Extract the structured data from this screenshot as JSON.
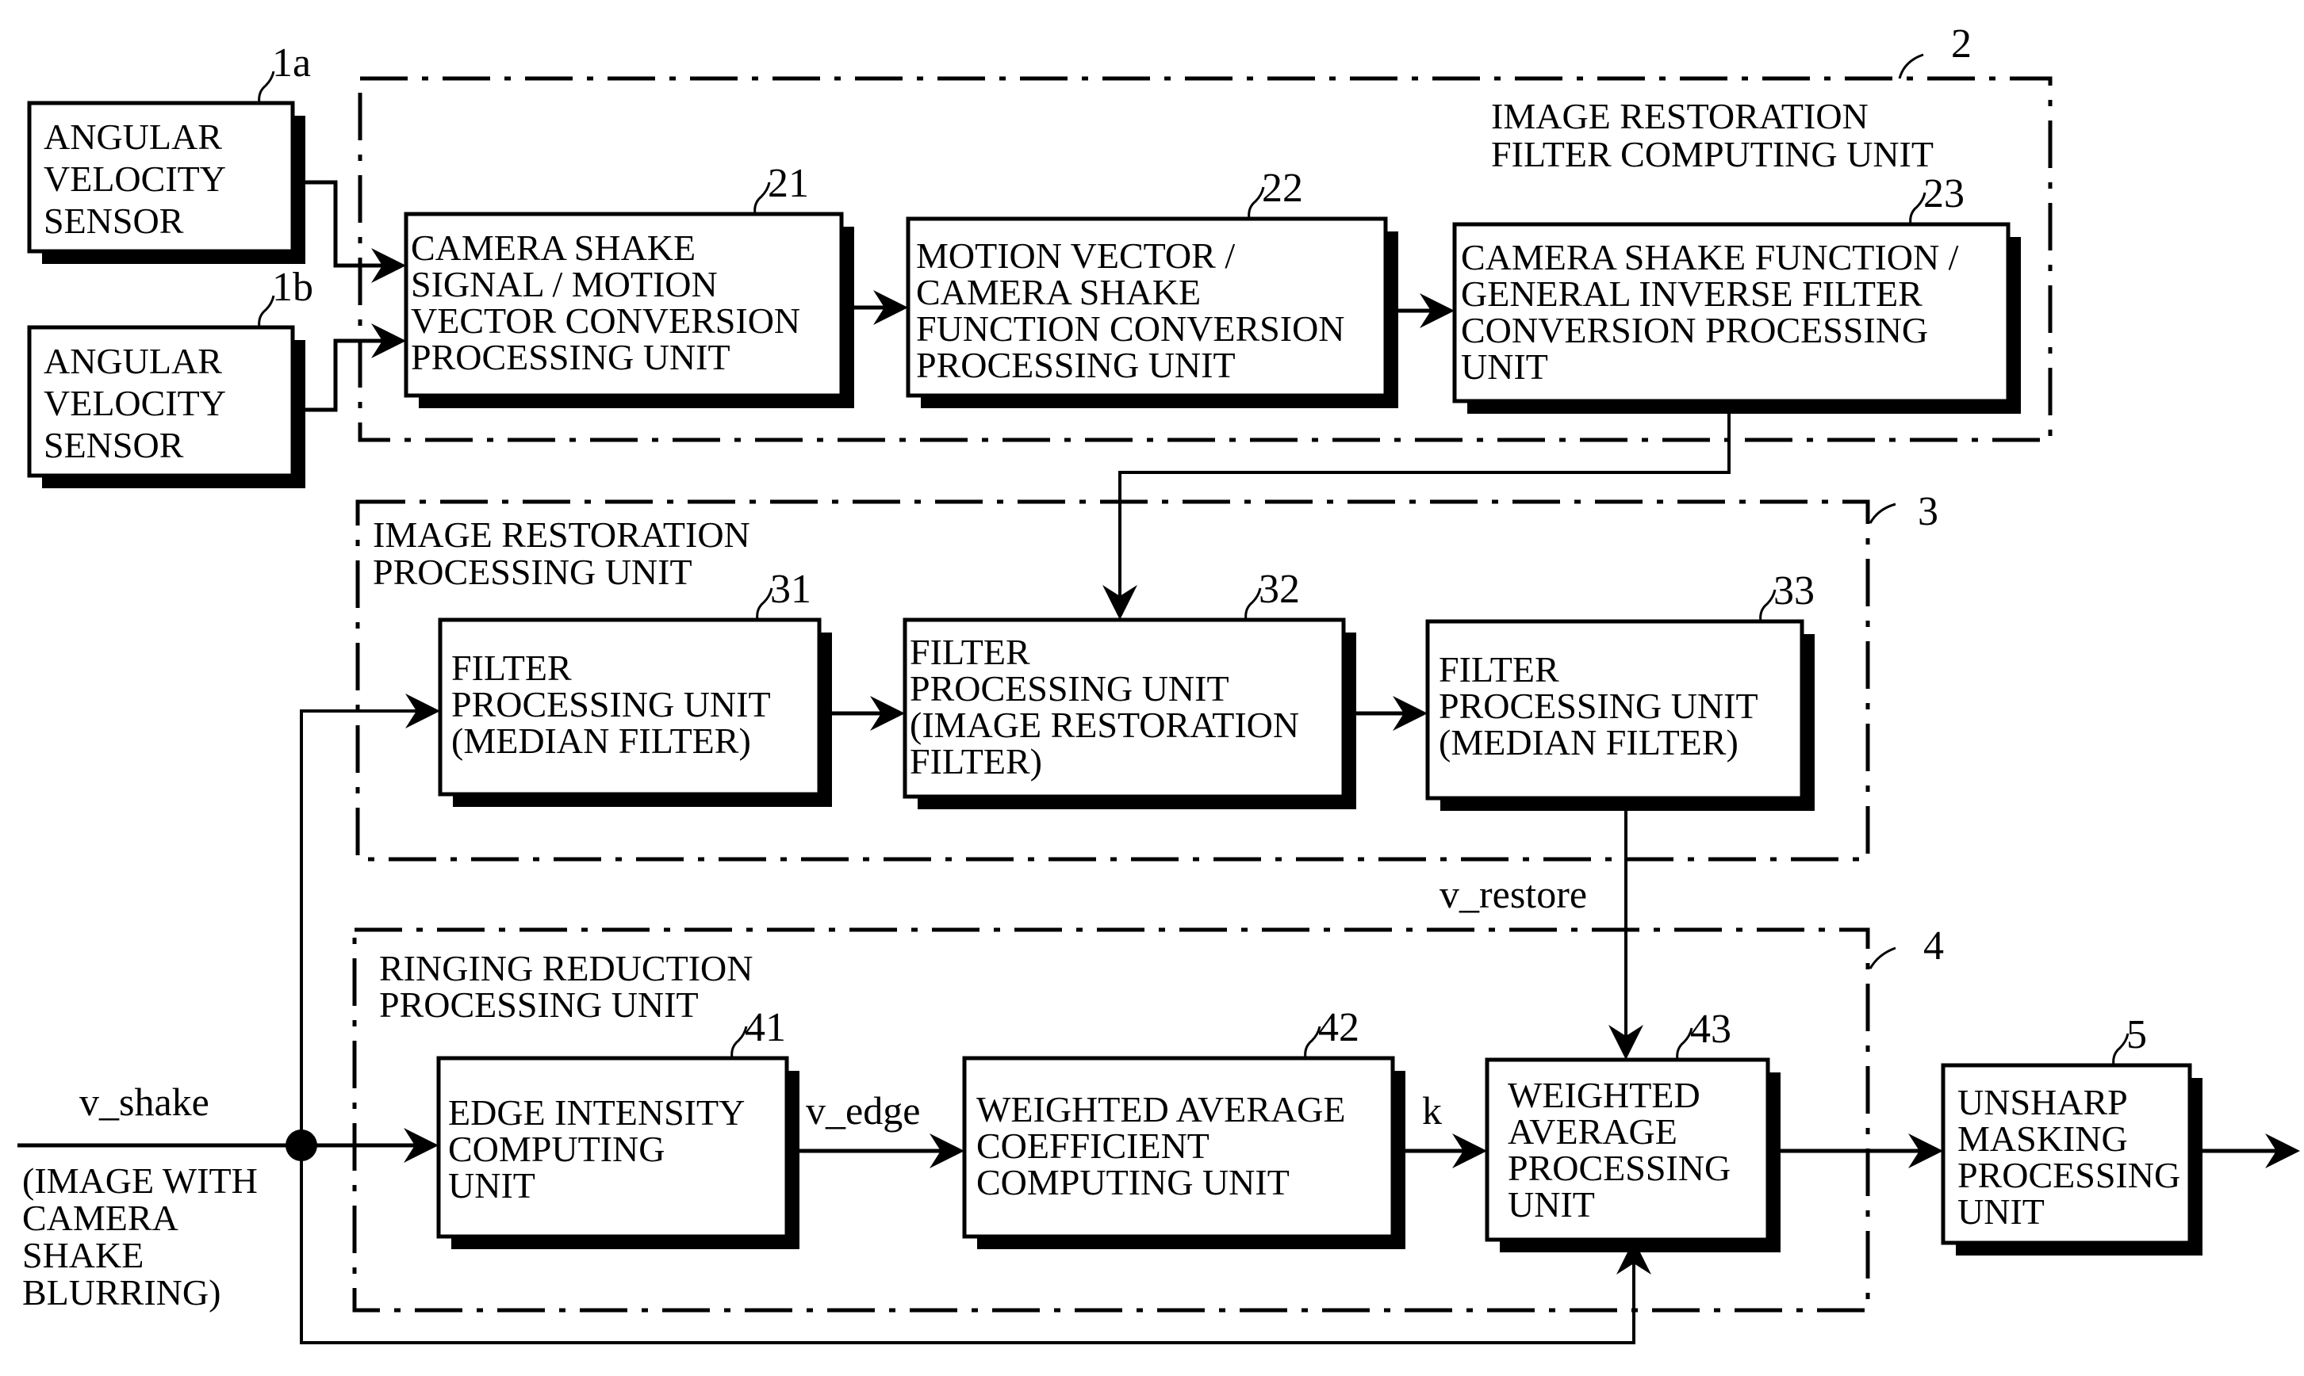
{
  "figure": {
    "groups": {
      "filter_computing": {
        "ref": "2",
        "title_lines": [
          "IMAGE RESTORATION",
          "FILTER COMPUTING UNIT"
        ]
      },
      "restoration_processing": {
        "ref": "3",
        "title_lines": [
          "IMAGE RESTORATION",
          "PROCESSING UNIT"
        ]
      },
      "ringing_reduction": {
        "ref": "4",
        "title_lines": [
          "RINGING REDUCTION",
          "PROCESSING UNIT"
        ]
      }
    },
    "blocks": {
      "sensor_1a": {
        "ref": "1a",
        "lines": [
          "ANGULAR",
          "VELOCITY",
          "SENSOR"
        ]
      },
      "sensor_1b": {
        "ref": "1b",
        "lines": [
          "ANGULAR",
          "VELOCITY",
          "SENSOR"
        ]
      },
      "b21": {
        "ref": "21",
        "lines": [
          "CAMERA SHAKE",
          "SIGNAL / MOTION",
          "VECTOR CONVERSION",
          "PROCESSING UNIT"
        ]
      },
      "b22": {
        "ref": "22",
        "lines": [
          "MOTION VECTOR /",
          "CAMERA SHAKE",
          "FUNCTION CONVERSION",
          "PROCESSING UNIT"
        ]
      },
      "b23": {
        "ref": "23",
        "lines": [
          "CAMERA SHAKE FUNCTION /",
          "GENERAL INVERSE FILTER",
          "CONVERSION PROCESSING",
          "UNIT"
        ]
      },
      "b31": {
        "ref": "31",
        "lines": [
          "FILTER",
          "PROCESSING  UNIT",
          "(MEDIAN FILTER)"
        ]
      },
      "b32": {
        "ref": "32",
        "lines": [
          "FILTER",
          "PROCESSING  UNIT",
          "(IMAGE RESTORATION",
          " FILTER)"
        ]
      },
      "b33": {
        "ref": "33",
        "lines": [
          "FILTER",
          "PROCESSING  UNIT",
          "(MEDIAN FILTER)"
        ]
      },
      "b41": {
        "ref": "41",
        "lines": [
          "EDGE INTENSITY",
          "COMPUTING",
          "UNIT"
        ]
      },
      "b42": {
        "ref": "42",
        "lines": [
          "WEIGHTED AVERAGE",
          "COEFFICIENT",
          "COMPUTING UNIT"
        ]
      },
      "b43": {
        "ref": "43",
        "lines": [
          "WEIGHTED",
          "AVERAGE",
          "PROCESSING",
          "UNIT"
        ]
      },
      "b5": {
        "ref": "5",
        "lines": [
          "UNSHARP",
          "MASKING",
          "PROCESSING",
          "UNIT"
        ]
      }
    },
    "signals": {
      "v_shake": "v_shake",
      "v_shake_note_lines": [
        "(IMAGE WITH",
        "CAMERA",
        "SHAKE",
        "BLURRING)"
      ],
      "v_restore": "v_restore",
      "v_edge": "v_edge",
      "k": "k"
    }
  }
}
